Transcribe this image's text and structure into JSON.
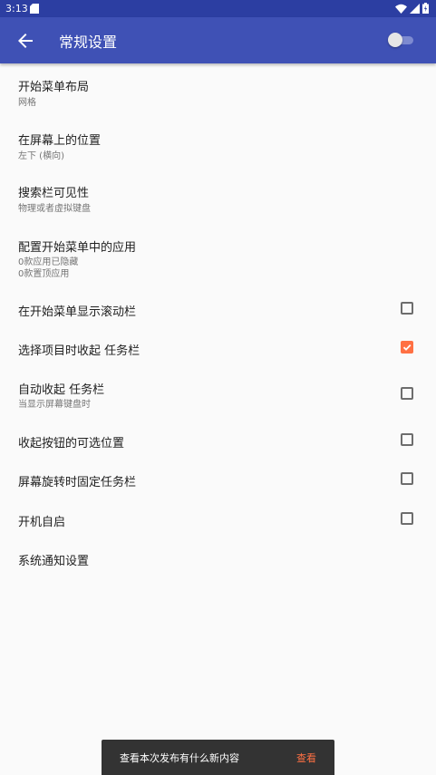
{
  "status_bar": {
    "time": "3:13",
    "left_icon": "sd-card-icon",
    "right_icons": [
      "wifi-icon",
      "cell-signal-icon",
      "battery-charging-icon"
    ]
  },
  "app_bar": {
    "title": "常规设置",
    "back_icon": "arrow-back-icon",
    "master_switch_on": false,
    "color": "#3f51b5"
  },
  "preferences": [
    {
      "title": "开始菜单布局",
      "summary": [
        "网格"
      ]
    },
    {
      "title": "在屏幕上的位置",
      "summary": [
        "左下 (横向)"
      ]
    },
    {
      "title": "搜索栏可见性",
      "summary": [
        "物理或者虚拟键盘"
      ]
    },
    {
      "title": "配置开始菜单中的应用",
      "summary": [
        "0款应用已隐藏",
        "0款置顶应用"
      ]
    },
    {
      "title": "在开始菜单显示滚动栏",
      "checked": false
    },
    {
      "title": "选择项目时收起 任务栏",
      "checked": true
    },
    {
      "title": "自动收起 任务栏",
      "summary": [
        "当显示屏幕键盘时"
      ],
      "checked": false
    },
    {
      "title": "收起按钮的可选位置",
      "checked": false
    },
    {
      "title": "屏幕旋转时固定任务栏",
      "checked": false
    },
    {
      "title": "开机自启",
      "checked": false
    },
    {
      "title": "系统通知设置"
    }
  ],
  "snackbar": {
    "message": "查看本次发布有什么新内容",
    "action": "查看"
  },
  "colors": {
    "status_bar": "#2c3ea2",
    "accent": "#ff7043",
    "background": "#fafafa"
  }
}
